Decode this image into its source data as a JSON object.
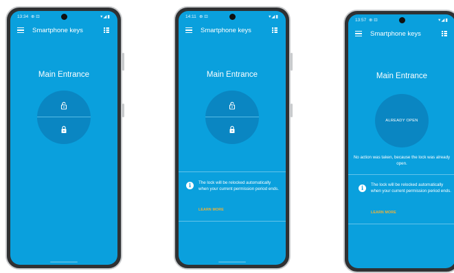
{
  "app_title": "Smartphone keys",
  "door_name": "Main Entrance",
  "phones": [
    {
      "time": "13:34"
    },
    {
      "time": "14:11"
    },
    {
      "time": "13:57"
    }
  ],
  "status_icons": "▾◢▮",
  "unlock_icon": "lock-open-icon",
  "lock_icon": "lock-icon",
  "notice": {
    "text": "The lock will be relocked automatically when your current permission period ends.",
    "learn_more": "LEARN MORE"
  },
  "already_open": {
    "label": "ALREADY OPEN",
    "message": "No action was taken, because the lock was already open."
  },
  "colors": {
    "screen": "#0aa0dd",
    "circle": "#0a86c2",
    "accent": "#f4b333",
    "frame": "#2f3133"
  }
}
